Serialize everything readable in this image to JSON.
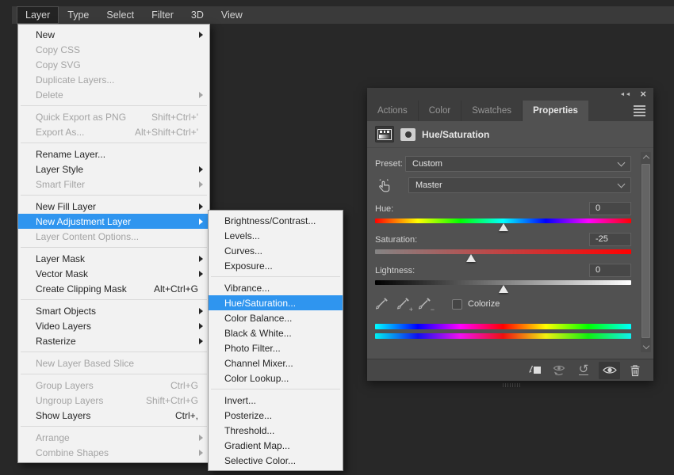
{
  "menubar": {
    "items": [
      {
        "label": "Layer",
        "active": true
      },
      {
        "label": "Type"
      },
      {
        "label": "Select"
      },
      {
        "label": "Filter"
      },
      {
        "label": "3D"
      },
      {
        "label": "View"
      }
    ]
  },
  "layer_menu": {
    "items": [
      {
        "label": "New",
        "submenu": true
      },
      {
        "label": "Copy CSS",
        "disabled": true
      },
      {
        "label": "Copy SVG",
        "disabled": true
      },
      {
        "label": "Duplicate Layers...",
        "disabled": true
      },
      {
        "label": "Delete",
        "disabled": true,
        "submenu": true
      },
      {
        "sep": true
      },
      {
        "label": "Quick Export as PNG",
        "shortcut": "Shift+Ctrl+'",
        "disabled": true
      },
      {
        "label": "Export As...",
        "shortcut": "Alt+Shift+Ctrl+'",
        "disabled": true
      },
      {
        "sep": true
      },
      {
        "label": "Rename Layer..."
      },
      {
        "label": "Layer Style",
        "submenu": true
      },
      {
        "label": "Smart Filter",
        "disabled": true,
        "submenu": true
      },
      {
        "sep": true
      },
      {
        "label": "New Fill Layer",
        "submenu": true
      },
      {
        "label": "New Adjustment Layer",
        "submenu": true,
        "highlighted": true
      },
      {
        "label": "Layer Content Options...",
        "disabled": true
      },
      {
        "sep": true
      },
      {
        "label": "Layer Mask",
        "submenu": true
      },
      {
        "label": "Vector Mask",
        "submenu": true
      },
      {
        "label": "Create Clipping Mask",
        "shortcut": "Alt+Ctrl+G"
      },
      {
        "sep": true
      },
      {
        "label": "Smart Objects",
        "submenu": true
      },
      {
        "label": "Video Layers",
        "submenu": true
      },
      {
        "label": "Rasterize",
        "submenu": true
      },
      {
        "sep": true
      },
      {
        "label": "New Layer Based Slice",
        "disabled": true
      },
      {
        "sep": true
      },
      {
        "label": "Group Layers",
        "shortcut": "Ctrl+G",
        "disabled": true
      },
      {
        "label": "Ungroup Layers",
        "shortcut": "Shift+Ctrl+G",
        "disabled": true
      },
      {
        "label": "Show Layers",
        "shortcut": "Ctrl+,"
      },
      {
        "sep": true
      },
      {
        "label": "Arrange",
        "disabled": true,
        "submenu": true
      },
      {
        "label": "Combine Shapes",
        "disabled": true,
        "submenu": true
      }
    ]
  },
  "adjustment_submenu": {
    "items": [
      {
        "label": "Brightness/Contrast..."
      },
      {
        "label": "Levels..."
      },
      {
        "label": "Curves..."
      },
      {
        "label": "Exposure..."
      },
      {
        "sep": true
      },
      {
        "label": "Vibrance..."
      },
      {
        "label": "Hue/Saturation...",
        "highlighted": true
      },
      {
        "label": "Color Balance..."
      },
      {
        "label": "Black & White..."
      },
      {
        "label": "Photo Filter..."
      },
      {
        "label": "Channel Mixer..."
      },
      {
        "label": "Color Lookup..."
      },
      {
        "sep": true
      },
      {
        "label": "Invert..."
      },
      {
        "label": "Posterize..."
      },
      {
        "label": "Threshold..."
      },
      {
        "label": "Gradient Map..."
      },
      {
        "label": "Selective Color..."
      }
    ]
  },
  "properties_panel": {
    "tabs": [
      {
        "label": "Actions"
      },
      {
        "label": "Color"
      },
      {
        "label": "Swatches"
      },
      {
        "label": "Properties",
        "active": true
      }
    ],
    "header": {
      "title": "Hue/Saturation"
    },
    "preset": {
      "label": "Preset:",
      "value": "Custom"
    },
    "channel": {
      "value": "Master"
    },
    "sliders": [
      {
        "label": "Hue:",
        "value": "0",
        "thumb_pct": 50,
        "gradient": "hue"
      },
      {
        "label": "Saturation:",
        "value": "-25",
        "thumb_pct": 37.5,
        "gradient": "saturation"
      },
      {
        "label": "Lightness:",
        "value": "0",
        "thumb_pct": 50,
        "gradient": "lightness"
      }
    ],
    "colorize": {
      "label": "Colorize",
      "checked": false
    },
    "footer_icon_names": [
      "clip-to-layer-icon",
      "previous-state-eye-icon",
      "reset-icon",
      "visibility-eye-icon",
      "trash-icon"
    ]
  },
  "icons": {
    "collapse": "◄◄",
    "close": "×",
    "reset": "↺"
  },
  "gradients": {
    "hue": [
      "#ff0000",
      "#ffff00",
      "#00ff00",
      "#00ffff",
      "#0000ff",
      "#ff00ff",
      "#ff0000"
    ],
    "saturation": [
      "#848484",
      "#ff0000"
    ],
    "lightness": [
      "#000000",
      "#808080",
      "#ffffff"
    ],
    "spectrum_top": [
      "#00ffff",
      "#0000ff",
      "#ff00ff",
      "#ff0000",
      "#ffff00",
      "#00ff00",
      "#00ffff"
    ],
    "spectrum_bottom": [
      "#00f0f0",
      "#1010f0",
      "#f010f0",
      "#f01010",
      "#f0f010",
      "#10f010",
      "#10f0f0"
    ]
  },
  "colors": {
    "desktop_bg": "#282828",
    "menubar_bg": "#3a3a3a",
    "menu_bg": "#f2f2f2",
    "menu_highlight": "#2f95ef",
    "menu_text": "#262626",
    "menu_disabled_text": "#a4a4a4",
    "panel_chrome": "#3d3d3d",
    "panel_bg": "#515151",
    "input_bg": "#474747",
    "input_border": "#616161"
  }
}
